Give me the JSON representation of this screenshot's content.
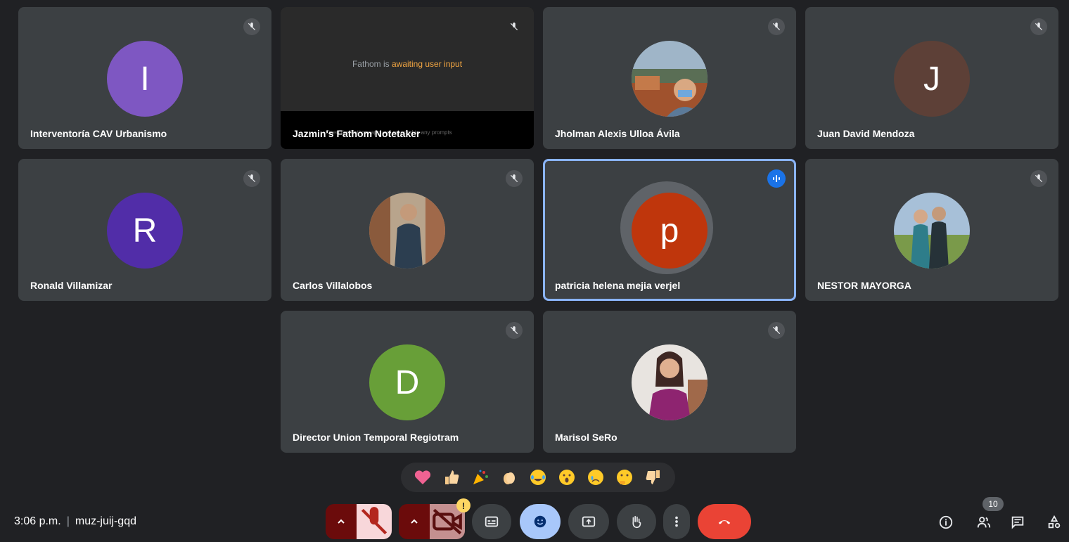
{
  "participants": [
    {
      "name": "Interventoría CAV Urbanismo",
      "initial": "I",
      "color": "#7e57c2"
    },
    {
      "name": "Jazmin's Fathom Notetaker",
      "status_prefix": "Fathom is",
      "status_highlight": "awaiting user input",
      "hint": "Open the Fathom app and respond to any prompts"
    },
    {
      "name": "Jholman Alexis Ulloa Ávila"
    },
    {
      "name": "Juan David Mendoza",
      "initial": "J",
      "color": "#5d4037"
    },
    {
      "name": "Ronald Villamizar",
      "initial": "R",
      "color": "#512da8"
    },
    {
      "name": "Carlos Villalobos"
    },
    {
      "name": "patricia helena mejia verjel",
      "initial": "p",
      "color": "#bf360c",
      "speaking": true
    },
    {
      "name": "NESTOR MAYORGA"
    },
    {
      "name": "Director Union Temporal Regiotram",
      "initial": "D",
      "color": "#689f38"
    },
    {
      "name": "Marisol SeRo"
    }
  ],
  "reactions": [
    "sparkling-heart",
    "thumbs-up",
    "party-popper",
    "clapping-hands",
    "tears-of-joy",
    "surprised",
    "crying",
    "thinking",
    "thumbs-down"
  ],
  "meeting": {
    "time": "3:06 p.m.",
    "code": "muz-juij-gqd"
  },
  "people_count": "10",
  "camera_warning": "!",
  "colors": {
    "background": "#202124",
    "tile": "#3c4043",
    "hangup": "#ea4335",
    "active_border": "#8ab4f8"
  }
}
